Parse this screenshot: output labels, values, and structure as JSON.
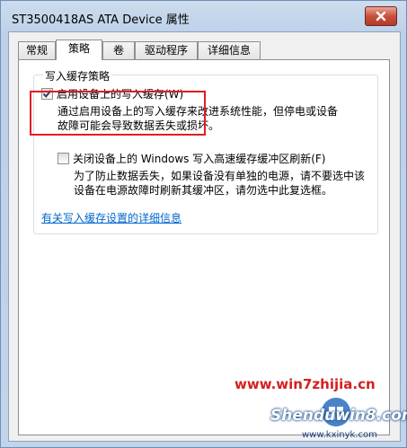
{
  "window": {
    "title": "ST3500418AS ATA Device 属性"
  },
  "tabs": [
    {
      "label": "常规",
      "active": false
    },
    {
      "label": "策略",
      "active": true
    },
    {
      "label": "卷",
      "active": false
    },
    {
      "label": "驱动程序",
      "active": false
    },
    {
      "label": "详细信息",
      "active": false
    }
  ],
  "write_cache": {
    "group_title": "写入缓存策略",
    "enable_checkbox": {
      "label": "启用设备上的写入缓存(W)",
      "checked": true
    },
    "enable_desc": "通过启用设备上的写入缓存来改进系统性能，但停电或设备\n故障可能会导致数据丢失或损坏。",
    "flush_checkbox": {
      "label": "关闭设备上的 Windows 写入高速缓存缓冲区刷新(F)",
      "checked": false
    },
    "flush_desc": "为了防止数据丢失，如果设备没有单独的电源，请不要选中该\n设备在电源故障时刷新其缓冲区，请勿选中此复选框。",
    "more_link": "有关写入缓存设置的详细信息"
  },
  "watermark": {
    "site1": "www.win7zhijia.cn",
    "site2": "Shenduwin8.com",
    "site3": "www.kxinyk.com"
  },
  "colors": {
    "highlight": "#e11d25",
    "link": "#0066cc"
  }
}
